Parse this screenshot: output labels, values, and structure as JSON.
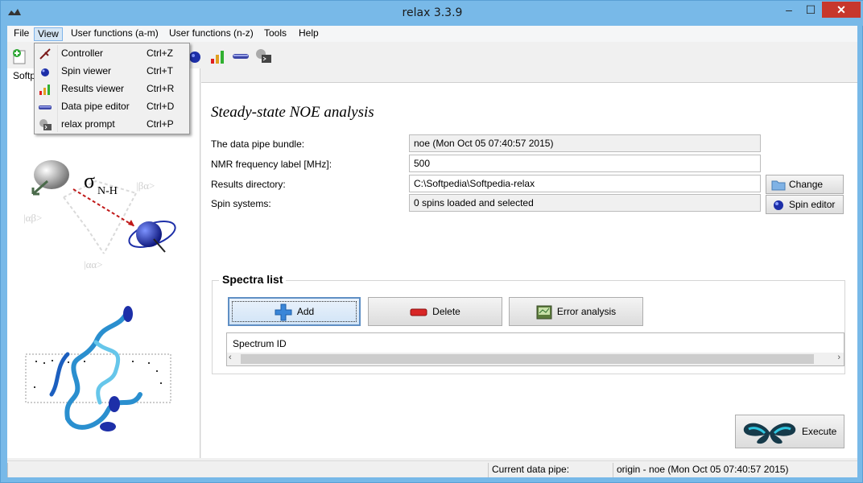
{
  "window": {
    "title": "relax 3.3.9",
    "min_glyph": "–",
    "max_glyph": "☐",
    "close_glyph": "✕"
  },
  "menubar": [
    "File",
    "View",
    "User functions (a-m)",
    "User functions (n-z)",
    "Tools",
    "Help"
  ],
  "view_menu": [
    {
      "label": "Controller",
      "shortcut": "Ctrl+Z",
      "icon": "controller-icon"
    },
    {
      "label": "Spin viewer",
      "shortcut": "Ctrl+T",
      "icon": "spin-viewer-icon"
    },
    {
      "label": "Results viewer",
      "shortcut": "Ctrl+R",
      "icon": "results-viewer-icon"
    },
    {
      "label": "Data pipe editor",
      "shortcut": "Ctrl+D",
      "icon": "data-pipe-editor-icon"
    },
    {
      "label": "relax prompt",
      "shortcut": "Ctrl+P",
      "icon": "relax-prompt-icon"
    }
  ],
  "left_panel": {
    "tab_label": "Softp",
    "sigma_label": "σ",
    "sigma_sub": "N-H",
    "state_labels": [
      "|βα>",
      "|αβ>",
      "|αα>"
    ]
  },
  "analysis": {
    "title": "Steady-state NOE analysis",
    "fields": [
      {
        "label": "The data pipe bundle:",
        "value": "noe (Mon Oct 05 07:40:57 2015)"
      },
      {
        "label": "NMR frequency label [MHz]:",
        "value": "500"
      },
      {
        "label": "Results directory:",
        "value": "C:\\Softpedia\\Softpedia-relax"
      },
      {
        "label": "Spin systems:",
        "value": "0 spins loaded and selected"
      }
    ],
    "change_button": "Change",
    "spin_editor_button": "Spin editor"
  },
  "spectra": {
    "title": "Spectra list",
    "add_button": "Add",
    "delete_button": "Delete",
    "error_button": "Error analysis",
    "column_header": "Spectrum ID",
    "scroll_left": "‹",
    "scroll_right": "›"
  },
  "execute_button": "Execute",
  "status": {
    "label": "Current data pipe:",
    "value": "origin - noe (Mon Oct 05 07:40:57 2015)"
  },
  "colors": {
    "title_bg": "#78b9e8",
    "close_bg": "#c7372c",
    "highlight": "#d5e6f5",
    "accent": "#5f8fc4"
  }
}
